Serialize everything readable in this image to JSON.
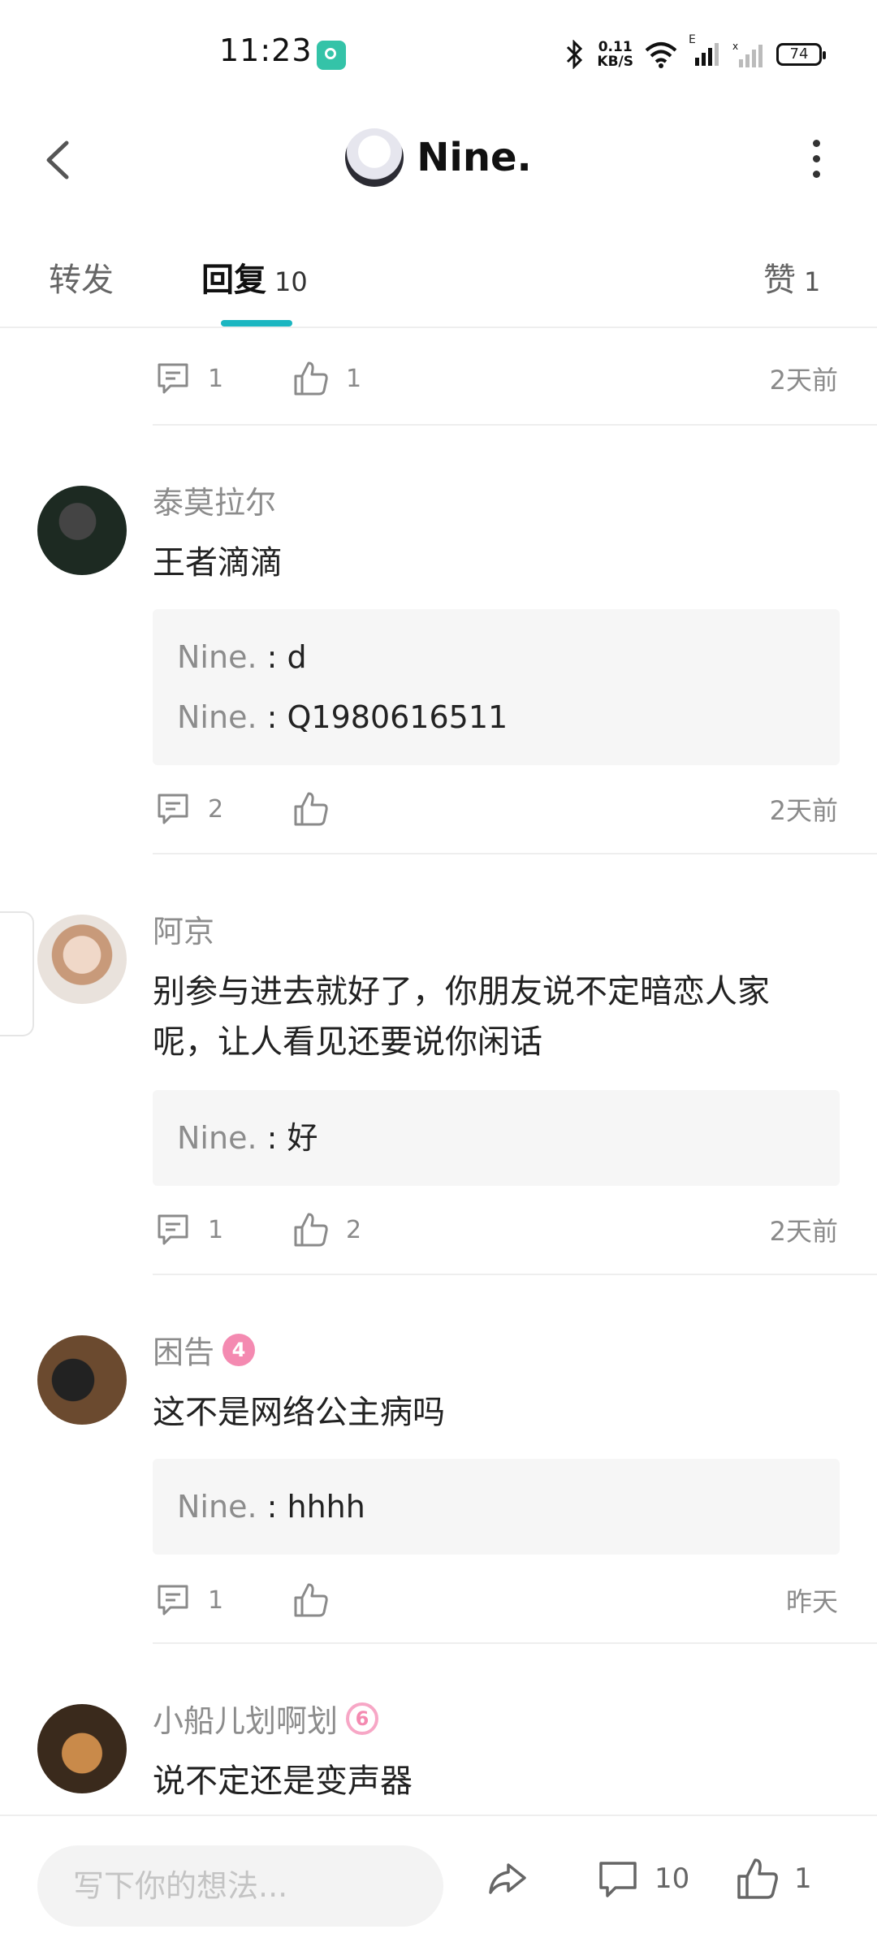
{
  "status_bar": {
    "time": "11:23",
    "net_speed_value": "0.11",
    "net_speed_unit": "KB/S",
    "network_type": "E",
    "battery": "74"
  },
  "header": {
    "title": "Nine."
  },
  "tabs": [
    {
      "label": "转发",
      "count": ""
    },
    {
      "label": "回复",
      "count": "10"
    },
    {
      "label": "赞",
      "count": "1"
    }
  ],
  "top_actions": {
    "comments": "1",
    "likes": "1",
    "time": "2天前"
  },
  "comments": [
    {
      "username": "泰莫拉尔",
      "badge": "",
      "text": "王者滴滴",
      "replies": [
        {
          "name": "Nine.",
          "sep": " : ",
          "text": "d"
        },
        {
          "name": "Nine.",
          "sep": " : ",
          "text": "Q1980616511"
        }
      ],
      "comments_count": "2",
      "likes_count": "",
      "time": "2天前"
    },
    {
      "username": "阿京",
      "badge": "",
      "text": "别参与进去就好了，你朋友说不定暗恋人家呢，让人看见还要说你闲话",
      "replies": [
        {
          "name": "Nine.",
          "sep": " : ",
          "text": "好"
        }
      ],
      "comments_count": "1",
      "likes_count": "2",
      "time": "2天前"
    },
    {
      "username": "困告",
      "badge": "4",
      "text": "这不是网络公主病吗",
      "replies": [
        {
          "name": "Nine.",
          "sep": " : ",
          "text": "hhhh"
        }
      ],
      "comments_count": "1",
      "likes_count": "",
      "time": "昨天"
    },
    {
      "username": "小船儿划啊划",
      "badge": "6",
      "text": "说不定还是变声器"
    }
  ],
  "bottom_bar": {
    "input_placeholder": "写下你的想法...",
    "comment_count": "10",
    "like_count": "1"
  },
  "colors": {
    "accent": "#1bb6c1",
    "badge_pink": "#f48ab1",
    "muted_text": "#8c8c8c"
  }
}
